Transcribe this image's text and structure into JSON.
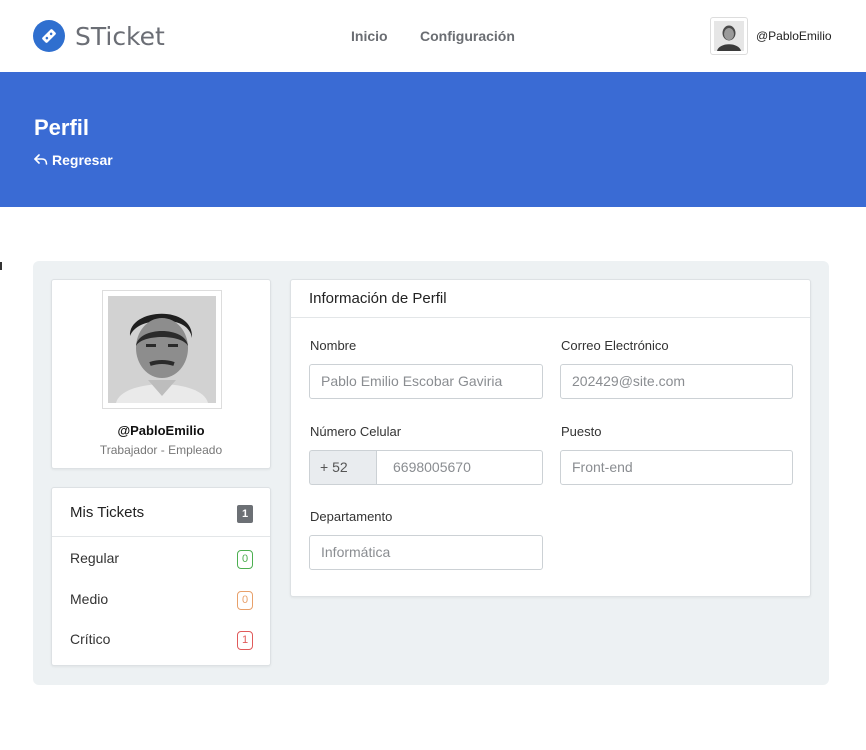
{
  "brand": {
    "name": "STicket",
    "icon": "ticket-icon",
    "color": "#2f6fcf"
  },
  "nav": {
    "links": [
      "Inicio",
      "Configuración"
    ],
    "username": "@PabloEmilio"
  },
  "hero": {
    "title": "Perfil",
    "back_label": "Regresar",
    "back_icon": "reply-icon",
    "background": "#3a6bd4"
  },
  "profile": {
    "handle": "@PabloEmilio",
    "role": "Trabajador - Empleado"
  },
  "tickets": {
    "title": "Mis Tickets",
    "total": "1",
    "items": [
      {
        "label": "Regular",
        "count": "0",
        "color": "#4caf50"
      },
      {
        "label": "Medio",
        "count": "0",
        "color": "#e8a06a"
      },
      {
        "label": "Crítico",
        "count": "1",
        "color": "#e05a5a"
      }
    ]
  },
  "info": {
    "title": "Información de Perfil",
    "name": {
      "label": "Nombre",
      "placeholder": "Pablo Emilio Escobar Gaviria"
    },
    "email": {
      "label": "Correo Electrónico",
      "placeholder": "202429@site.com"
    },
    "phone": {
      "label": "Número Celular",
      "prefix": "+ 52",
      "placeholder": "6698005670"
    },
    "position": {
      "label": "Puesto",
      "placeholder": "Front-end"
    },
    "department": {
      "label": "Departamento",
      "placeholder": "Informática"
    }
  }
}
